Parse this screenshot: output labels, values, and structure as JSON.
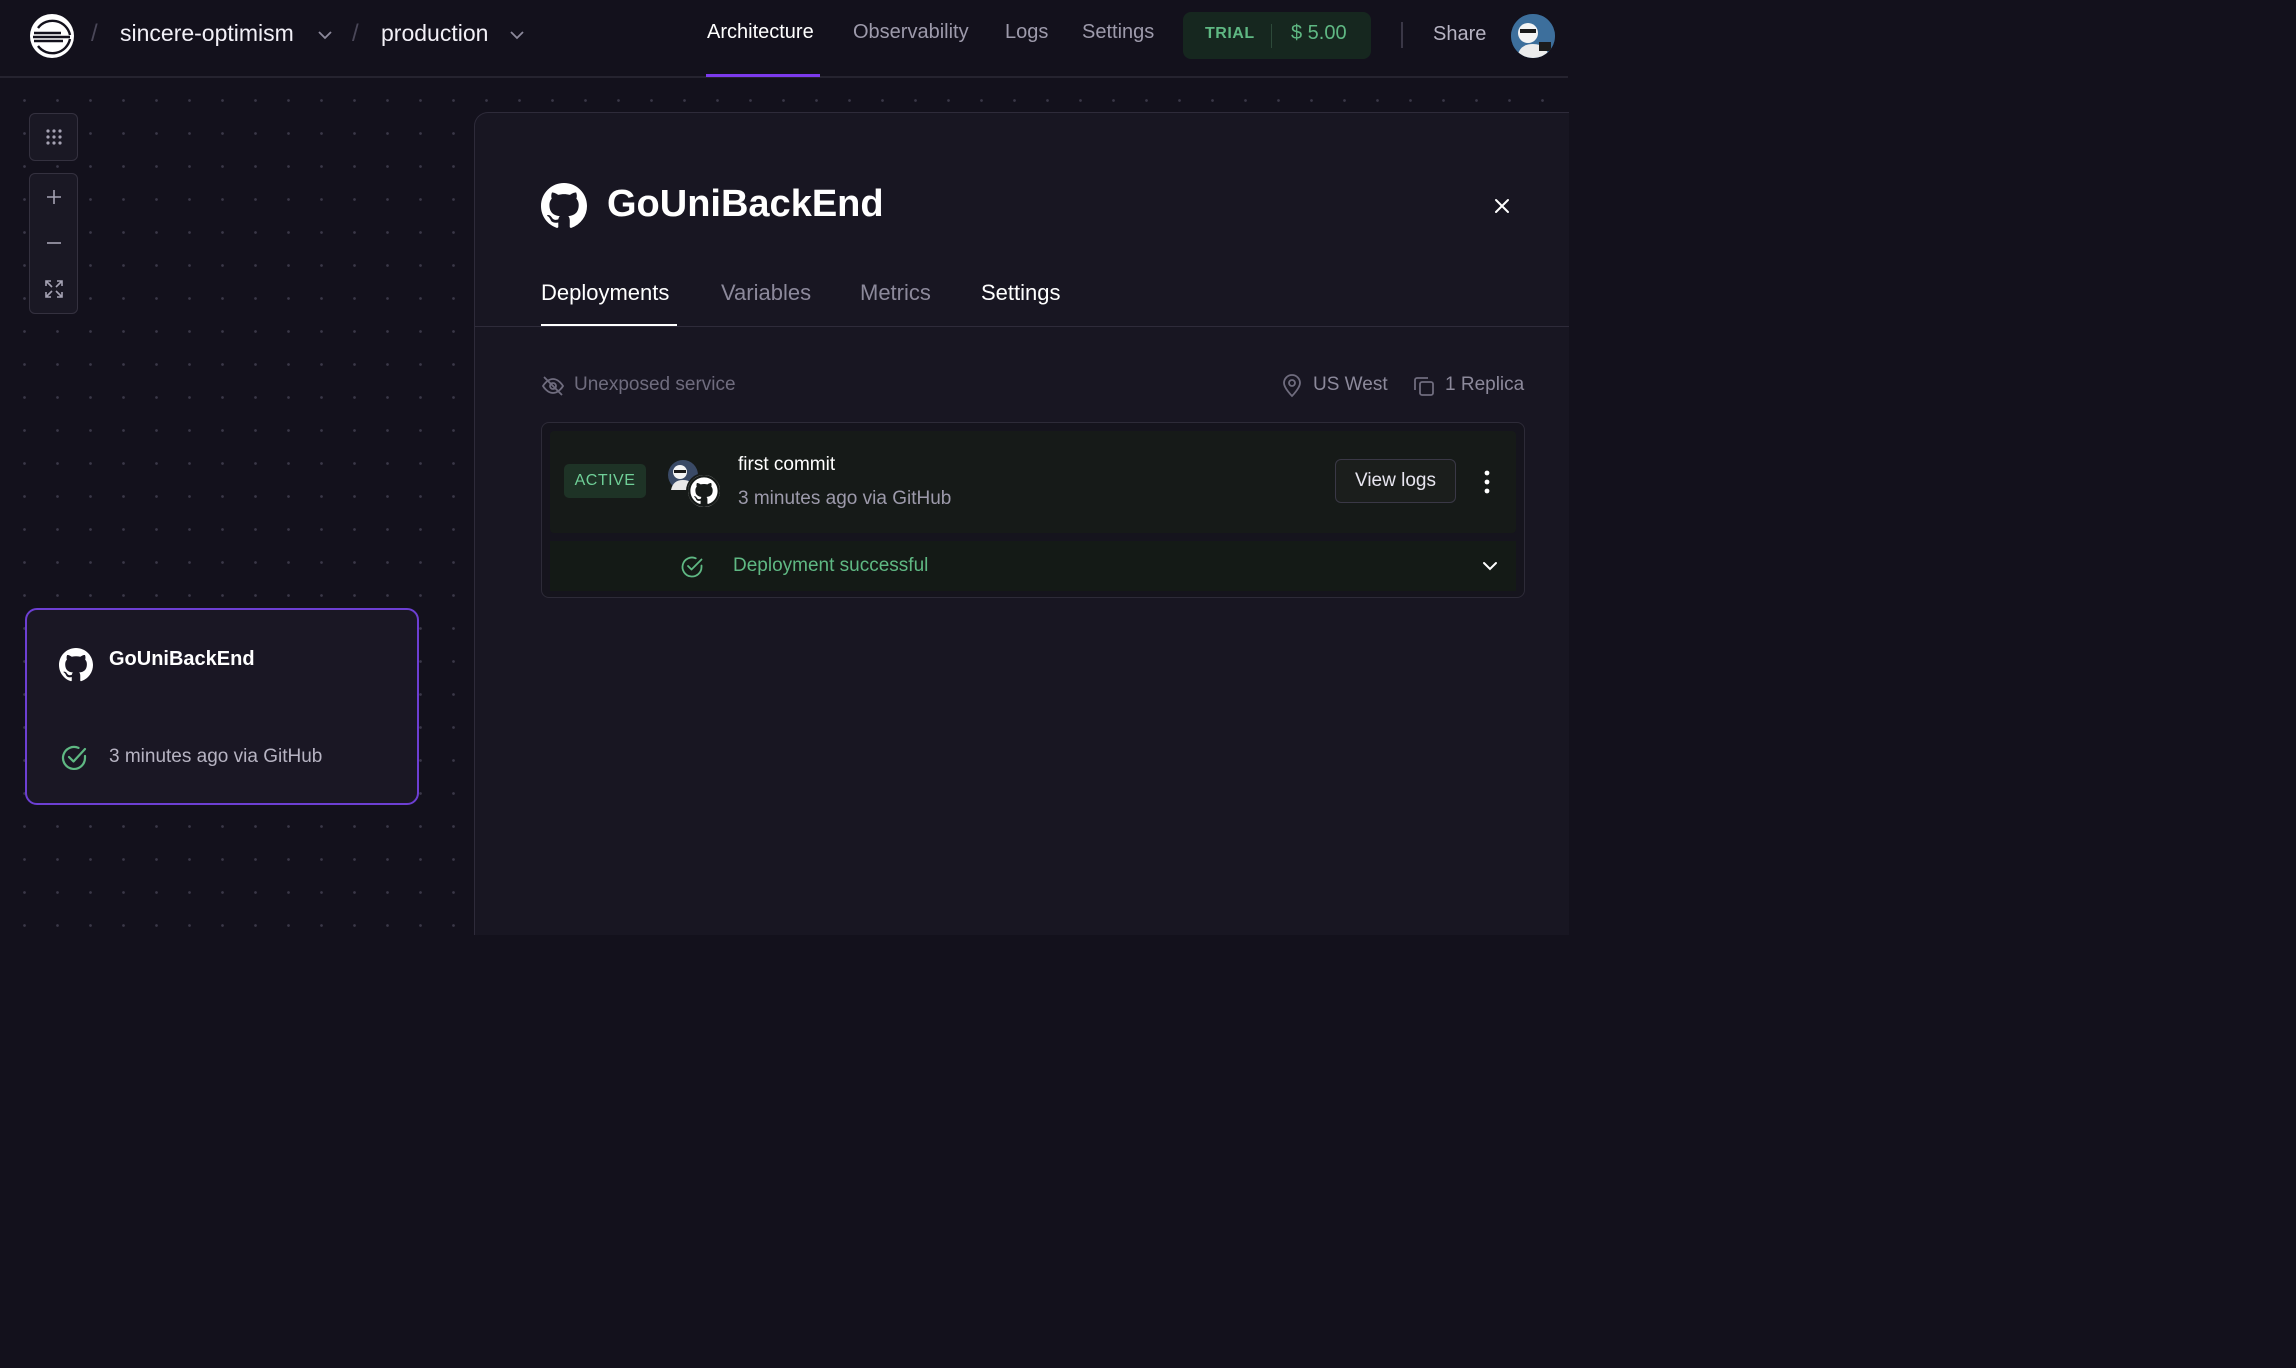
{
  "header": {
    "project": "sincere-optimism",
    "environment": "production",
    "nav": [
      "Architecture",
      "Observability",
      "Logs",
      "Settings"
    ],
    "active_nav": "Architecture",
    "trial_label": "TRIAL",
    "trial_amount": "$ 5.00",
    "share_label": "Share",
    "breadcrumb_separator": "/"
  },
  "canvas_tools": [
    "grid-icon",
    "plus-icon",
    "minus-icon",
    "fit-view-icon"
  ],
  "service_card": {
    "name": "GoUniBackEnd",
    "status": "3 minutes ago via GitHub"
  },
  "panel": {
    "title": "GoUniBackEnd",
    "tabs": [
      "Deployments",
      "Variables",
      "Metrics",
      "Settings"
    ],
    "active_tab": "Deployments",
    "exposure": "Unexposed service",
    "region": "US West",
    "replicas": "1 Replica",
    "deployment": {
      "badge": "ACTIVE",
      "commit_message": "first commit",
      "meta": "3 minutes ago via GitHub",
      "view_logs_label": "View logs",
      "status": "Deployment successful"
    }
  },
  "colors": {
    "background": "#13111c",
    "accent": "#7c3aed",
    "success": "#5fb883"
  }
}
